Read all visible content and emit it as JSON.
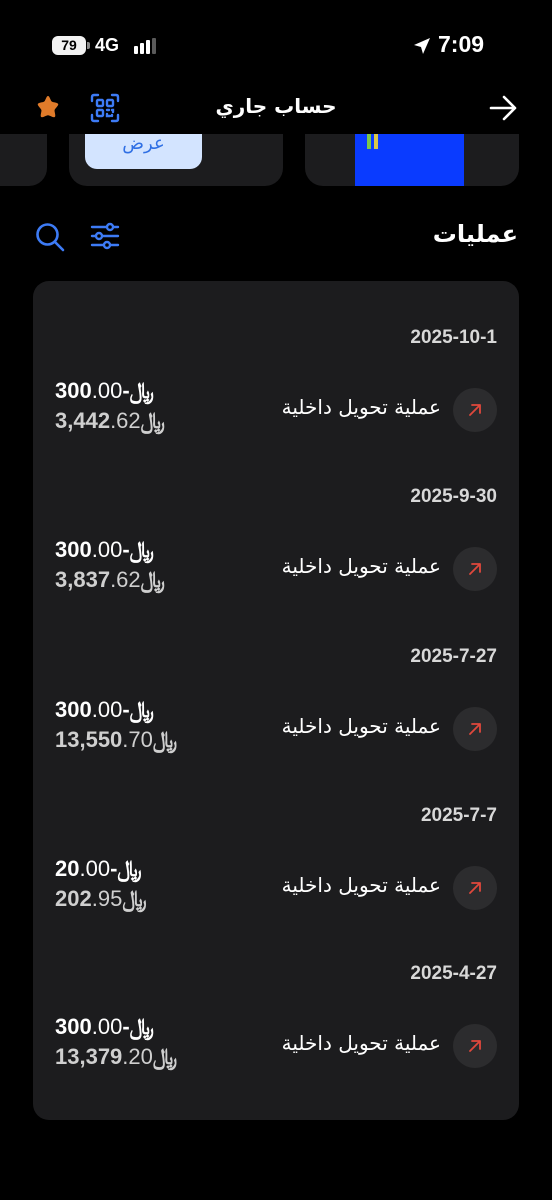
{
  "status_bar": {
    "battery": "79",
    "network": "4G",
    "time": "7:09"
  },
  "header": {
    "title": "حساب جاري"
  },
  "cards": {
    "view_label": "عرض"
  },
  "section": {
    "title": "عمليات"
  },
  "currency_symbol": "﷼",
  "transactions": [
    {
      "date": "2025-10-1",
      "label": "عملية تحويل داخلية",
      "amount_int": "-300",
      "amount_dec": ".00",
      "balance_int": "3,442",
      "balance_dec": ".62"
    },
    {
      "date": "2025-9-30",
      "label": "عملية تحويل داخلية",
      "amount_int": "-300",
      "amount_dec": ".00",
      "balance_int": "3,837",
      "balance_dec": ".62"
    },
    {
      "date": "2025-7-27",
      "label": "عملية تحويل داخلية",
      "amount_int": "-300",
      "amount_dec": ".00",
      "balance_int": "13,550",
      "balance_dec": ".70"
    },
    {
      "date": "2025-7-7",
      "label": "عملية تحويل داخلية",
      "amount_int": "-20",
      "amount_dec": ".00",
      "balance_int": "202",
      "balance_dec": ".95"
    },
    {
      "date": "2025-4-27",
      "label": "عملية تحويل داخلية",
      "amount_int": "-300",
      "amount_dec": ".00",
      "balance_int": "13,379",
      "balance_dec": ".20"
    }
  ],
  "colors": {
    "background": "#000000",
    "panel": "#1c1c1e",
    "accent_blue": "#3d7bf5",
    "arrow_red": "#e0483c",
    "star_orange": "#e07b2a"
  },
  "icons": [
    "star-icon",
    "qr-code-icon",
    "back-arrow-icon",
    "search-icon",
    "filter-icon",
    "outgoing-arrow-icon",
    "location-icon"
  ]
}
